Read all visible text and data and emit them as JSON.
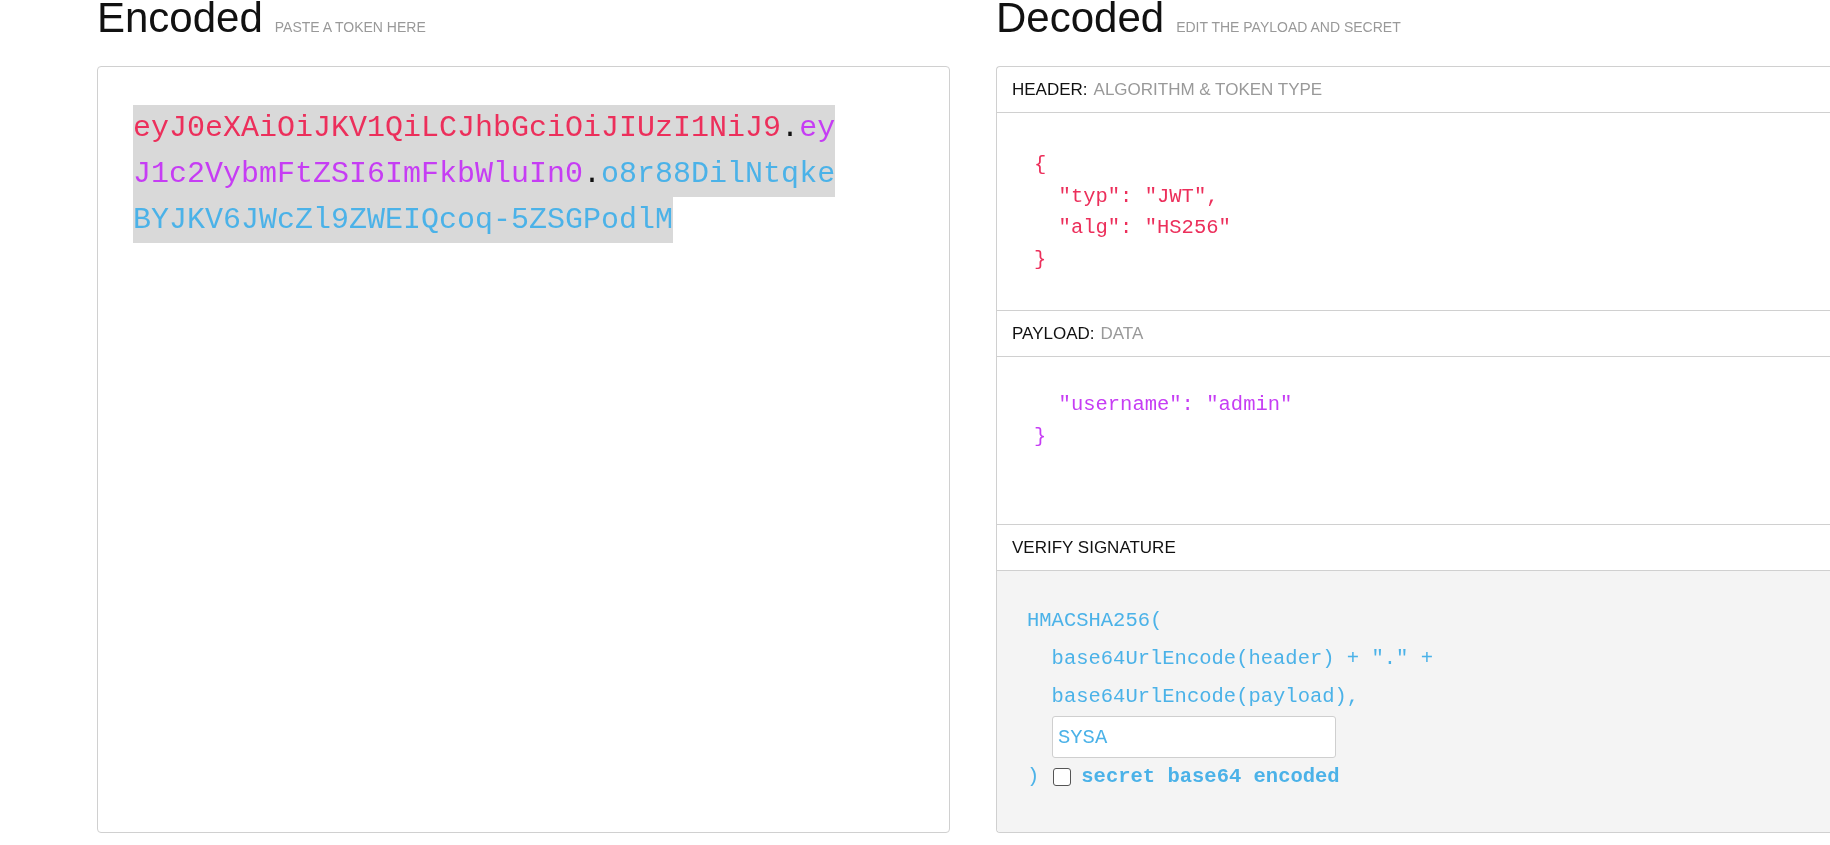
{
  "encoded": {
    "title": "Encoded",
    "hint": "PASTE A TOKEN HERE",
    "token": {
      "highlighted": true,
      "parts": [
        {
          "kind": "header",
          "text": "eyJ0eXAiOiJKV1QiLCJhbGciOiJIUzI1NiJ9"
        },
        {
          "kind": "separator",
          "text": "."
        },
        {
          "kind": "payload",
          "text": "eyJ1c2VybmFtZSI6ImFkbWluIn0"
        },
        {
          "kind": "separator",
          "text": "."
        },
        {
          "kind": "signature",
          "text": "o8r88DilNtqkeBYJKV6JWcZl9ZWEIQcoq-5ZSGPodlM"
        }
      ]
    }
  },
  "decoded": {
    "title": "Decoded",
    "hint": "EDIT THE PAYLOAD AND SECRET",
    "sections": [
      {
        "kind": "header",
        "label": "HEADER:",
        "sublabel": "ALGORITHM & TOKEN TYPE",
        "lines": [
          "{",
          "  \"typ\": \"JWT\",",
          "  \"alg\": \"HS256\"",
          "}"
        ]
      },
      {
        "kind": "payload",
        "label": "PAYLOAD:",
        "sublabel": "DATA",
        "lines": [
          "  \"username\": \"admin\"",
          "}"
        ]
      },
      {
        "kind": "signature",
        "label": "VERIFY SIGNATURE",
        "lines": [
          "HMACSHA256(",
          "  base64UrlEncode(header) + \".\" +",
          "  base64UrlEncode(payload),"
        ],
        "secret": {
          "value": "SYSA"
        },
        "close": ")",
        "checkbox": {
          "label": "secret base64 encoded",
          "checked": false
        }
      }
    ]
  }
}
